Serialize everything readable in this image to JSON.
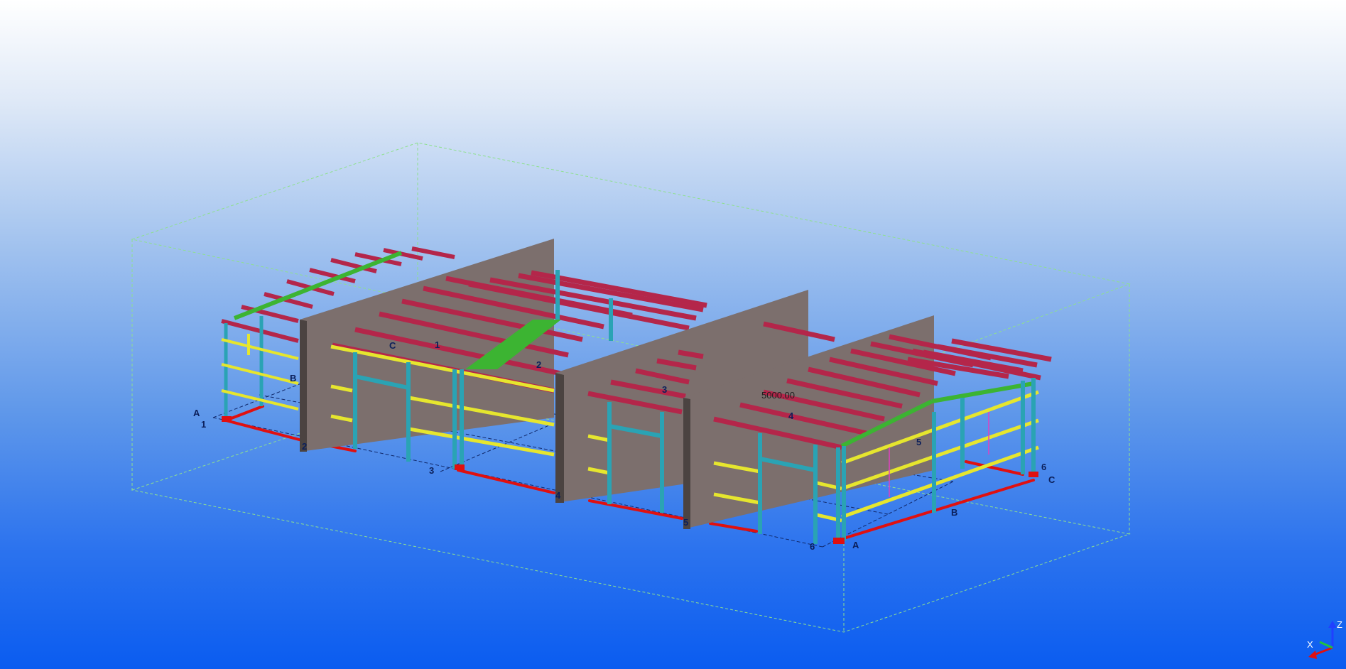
{
  "viewport": {
    "background_top": "#ffffff",
    "background_bottom": "#0a5cf0"
  },
  "grid_labels": {
    "numbers": [
      "1",
      "2",
      "3",
      "4",
      "5",
      "6"
    ],
    "letters": [
      "A",
      "B",
      "C"
    ]
  },
  "dimension": "5000.00",
  "axes": {
    "z": "Z",
    "x": "X"
  },
  "colors": {
    "purlin": "#b4264a",
    "girt": "#e6e62e",
    "column": "#2aa3b4",
    "bracing": "#3cb432",
    "base_line": "#e01010",
    "wall": "#7c6f6d",
    "bbox": "#8ee08e",
    "grid": "#10286a"
  }
}
